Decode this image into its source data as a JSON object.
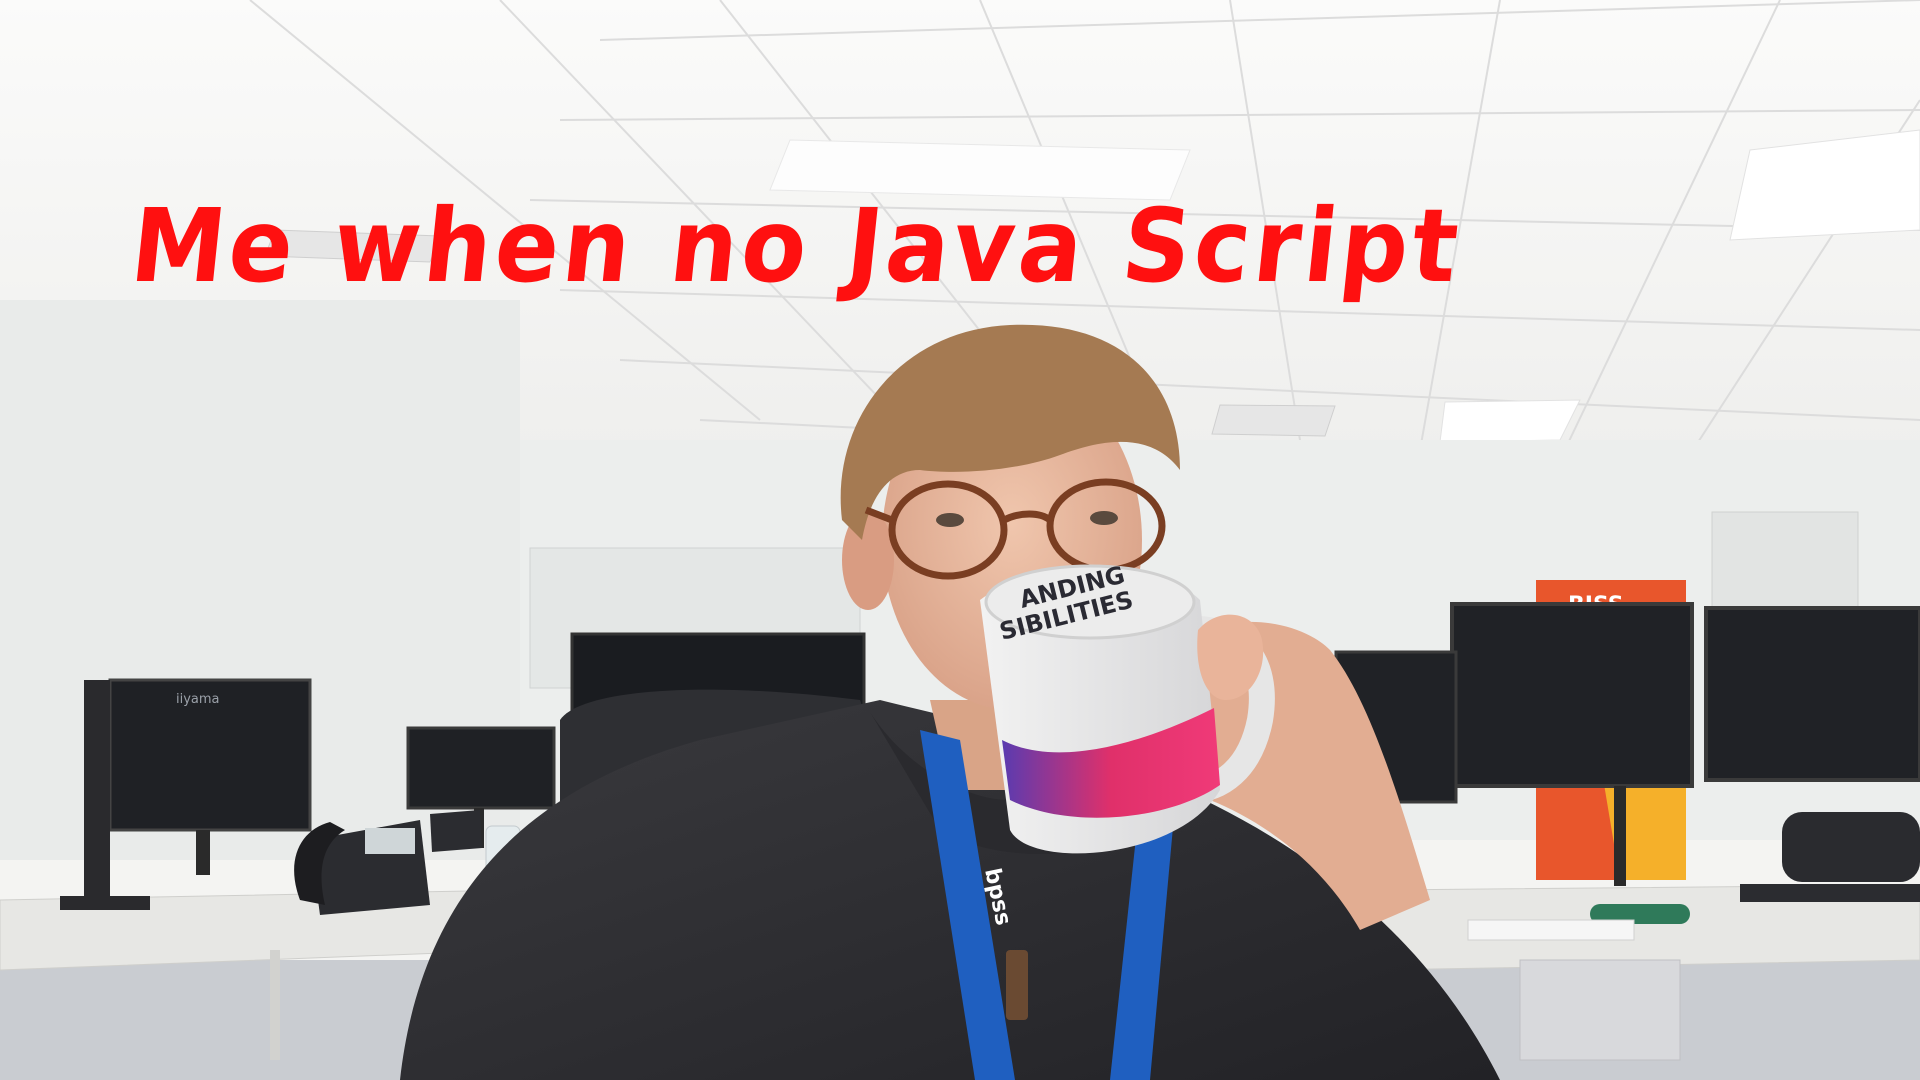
{
  "caption": "Me when no Java Script",
  "mug": {
    "line1": "ANDING",
    "line2": "SIBILITIES"
  },
  "monitor_brand": "iiyama",
  "banner": "BISS",
  "lanyard": "bpss"
}
